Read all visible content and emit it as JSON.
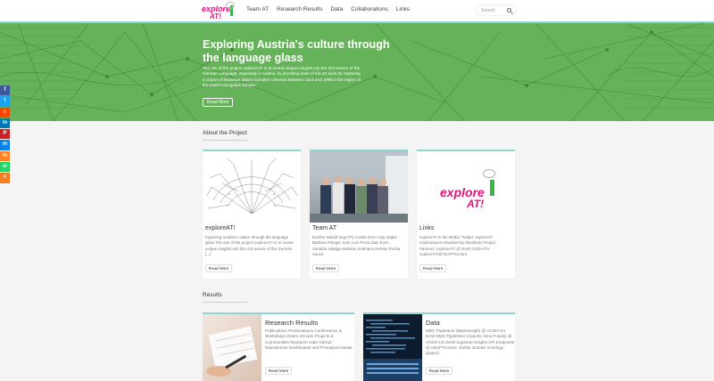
{
  "header": {
    "logo_top": "explore",
    "logo_bottom": "AT!",
    "nav": [
      "Team AT",
      "Research Results",
      "Data",
      "Collaborations",
      "Links"
    ],
    "search_placeholder": "Search"
  },
  "hero": {
    "title": "Exploring Austria's culture through the language glass",
    "description": "The aim of the project exploreAT! is to reveal unique insights into the rich texture of the German Language, especially in Austria, by providing state of the art tools for exploring a corpus of Bavarian dialect samples collected between 1913 and 1998 in the region of the Austro-Hungarian Empire.",
    "button": "Read More"
  },
  "social": [
    {
      "name": "facebook",
      "color": "#3b5998",
      "glyph": "f"
    },
    {
      "name": "twitter",
      "color": "#1da1f2",
      "glyph": "t"
    },
    {
      "name": "reddit",
      "color": "#ff4500",
      "glyph": "r"
    },
    {
      "name": "linkedin",
      "color": "#0077b5",
      "glyph": "in"
    },
    {
      "name": "pinterest",
      "color": "#cb2027",
      "glyph": "P"
    },
    {
      "name": "mewe",
      "color": "#0e81e5",
      "glyph": "m"
    },
    {
      "name": "mix",
      "color": "#ff8226",
      "glyph": "m"
    },
    {
      "name": "whatsapp",
      "color": "#25d366",
      "glyph": "w"
    },
    {
      "name": "share",
      "color": "#f57e20",
      "glyph": "<"
    }
  ],
  "about": {
    "title": "About the Project",
    "cards": [
      {
        "title": "exploreAT!",
        "text": "Exploring Austria's culture through the language glass The aim of the project exploreAT! is to reveal unique insights into the rich texture of the German [...]",
        "button": "Read More"
      },
      {
        "title": "Team AT",
        "text": "Eveline Wandl-Vogt (PI) Amelie Dorn Anja Zagler Barbara Piringer Jose Luis Preza Diaz Enric Senabre Hidalgo Melanie Seltmann Renato Rocha Souza",
        "button": "Read More"
      },
      {
        "title": "Links",
        "text": "exploreAT in the Media: Twitter: exploreAT explorationAs Biodiversity Manifesto Project Partners: exploreAT! @ OAW ACDH-CH exploreAT!@ADAPTCentre",
        "button": "Read More"
      }
    ]
  },
  "results": {
    "title": "Results",
    "cards": [
      {
        "title": "Research Results",
        "text": "Publications Presentations Conferences & Workshops Zotero Zenodo Projects & Communities Research Gate GitHub Repositories Dashboards and Prototypes Media",
        "button": "Read More"
      },
      {
        "title": "Data",
        "text": "DBO Triplestore (BlazeGraph) @ ACDH-CH DAW DBO Triplestore (Apache Jena Fuseki) @ ACDH-CH DAW Superset Graphs API Endpoints @ ADAPTCentre, Dublin Ontolex Ontology (paper)",
        "button": "Read More"
      }
    ]
  },
  "colors": {
    "accent": "#8ed6d3",
    "hero": "#66b25a",
    "brand": "#e0157d"
  }
}
